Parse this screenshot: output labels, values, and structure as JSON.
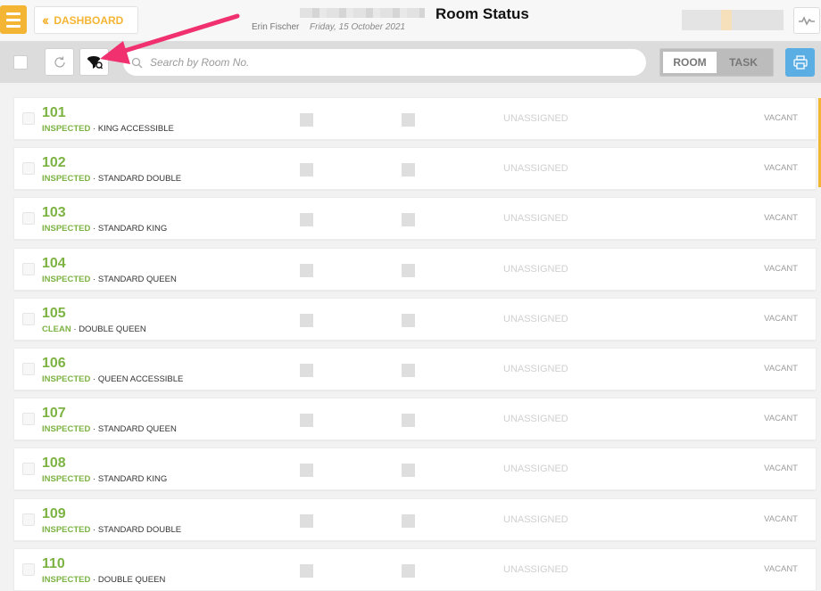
{
  "header": {
    "dashboard_label": "DASHBOARD",
    "title": "Room Status",
    "user_name": "Erin Fischer",
    "date": "Friday, 15 October 2021"
  },
  "toolbar": {
    "search_placeholder": "Search by Room No.",
    "toggle_room": "ROOM",
    "toggle_task": "TASK"
  },
  "colors": {
    "accent": "#f5b534",
    "status_green": "#7cb342",
    "print_button": "#5aaee3",
    "annotation_arrow": "#f0306f"
  },
  "icons": [
    "menu-icon",
    "chevron-double-left-icon",
    "pulse-icon",
    "refresh-icon",
    "filter-icon",
    "search-icon",
    "printer-icon"
  ],
  "rooms": [
    {
      "number": "101",
      "status": "INSPECTED",
      "type": "KING ACCESSIBLE",
      "assignee": "UNASSIGNED",
      "occupancy": "VACANT"
    },
    {
      "number": "102",
      "status": "INSPECTED",
      "type": "STANDARD DOUBLE",
      "assignee": "UNASSIGNED",
      "occupancy": "VACANT"
    },
    {
      "number": "103",
      "status": "INSPECTED",
      "type": "STANDARD KING",
      "assignee": "UNASSIGNED",
      "occupancy": "VACANT"
    },
    {
      "number": "104",
      "status": "INSPECTED",
      "type": "STANDARD QUEEN",
      "assignee": "UNASSIGNED",
      "occupancy": "VACANT"
    },
    {
      "number": "105",
      "status": "CLEAN",
      "type": "DOUBLE QUEEN",
      "assignee": "UNASSIGNED",
      "occupancy": "VACANT"
    },
    {
      "number": "106",
      "status": "INSPECTED",
      "type": "QUEEN ACCESSIBLE",
      "assignee": "UNASSIGNED",
      "occupancy": "VACANT"
    },
    {
      "number": "107",
      "status": "INSPECTED",
      "type": "STANDARD QUEEN",
      "assignee": "UNASSIGNED",
      "occupancy": "VACANT"
    },
    {
      "number": "108",
      "status": "INSPECTED",
      "type": "STANDARD KING",
      "assignee": "UNASSIGNED",
      "occupancy": "VACANT"
    },
    {
      "number": "109",
      "status": "INSPECTED",
      "type": "STANDARD DOUBLE",
      "assignee": "UNASSIGNED",
      "occupancy": "VACANT"
    },
    {
      "number": "110",
      "status": "INSPECTED",
      "type": "DOUBLE QUEEN",
      "assignee": "UNASSIGNED",
      "occupancy": "VACANT"
    }
  ]
}
